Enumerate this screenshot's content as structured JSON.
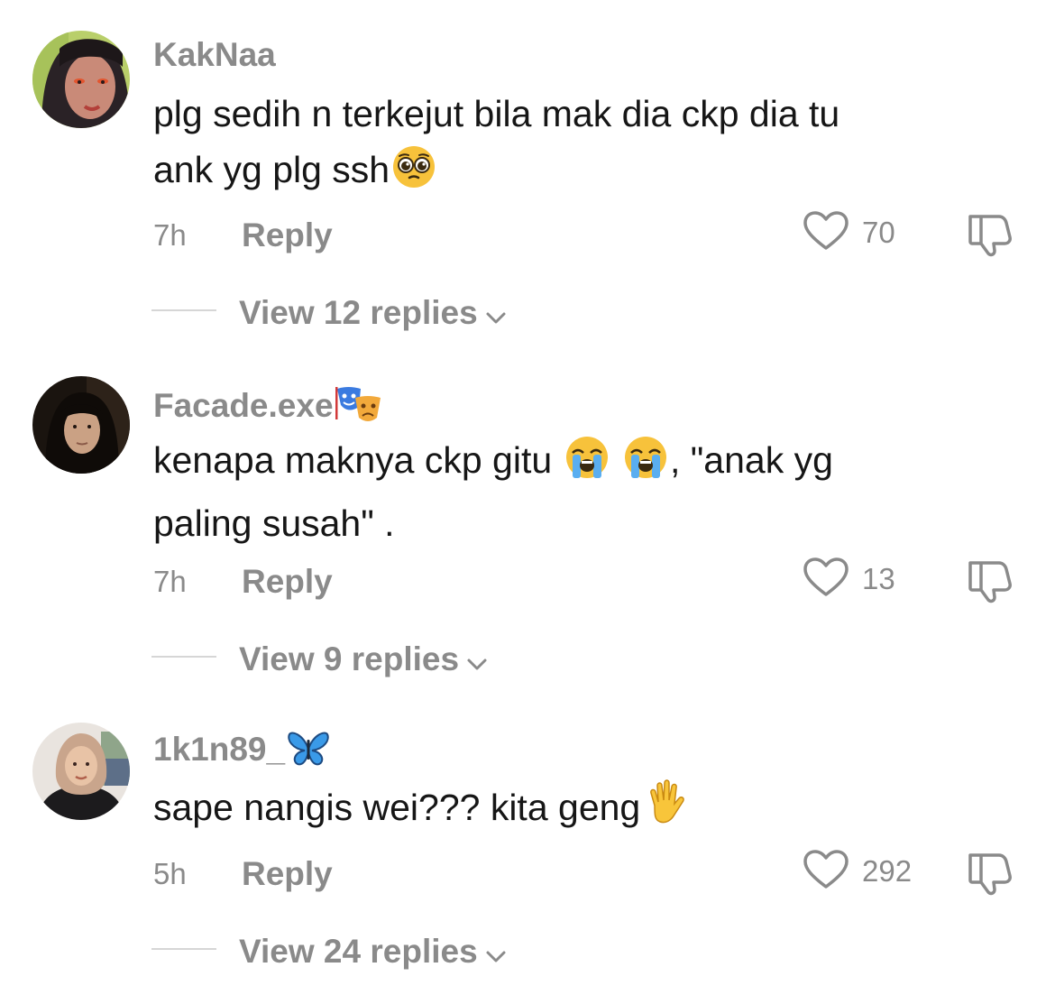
{
  "comments": [
    {
      "username": "KakNaa",
      "username_emoji": "",
      "text_lines": [
        "plg sedih n terkejut bila mak dia ckp dia tu",
        "ank yg plg ssh"
      ],
      "text_emoji": "pleading-face",
      "time": "7h",
      "reply_label": "Reply",
      "likes": "70",
      "view_replies": "View 12 replies"
    },
    {
      "username": "Facade.exe",
      "username_emoji": "performing-arts",
      "text_part1": "kenapa maknya ckp gitu",
      "text_part2": ", \"anak yg",
      "text_line2": "paling susah\" .",
      "text_emoji": "loudly-crying-face",
      "time": "7h",
      "reply_label": "Reply",
      "likes": "13",
      "view_replies": "View 9 replies"
    },
    {
      "username": "1k1n89_",
      "username_emoji": "butterfly",
      "text_line1": "sape nangis wei??? kita geng",
      "text_emoji": "raised-hand",
      "time": "5h",
      "reply_label": "Reply",
      "likes": "292",
      "view_replies": "View 24 replies"
    }
  ],
  "colors": {
    "secondary_text": "#8a8a8a",
    "primary_text": "#161616",
    "divider": "#d6d6d6",
    "background": "#ffffff"
  },
  "icons": {
    "like": "heart-outline-icon",
    "dislike": "thumbs-down-outline-icon",
    "expand": "chevron-down-icon"
  }
}
